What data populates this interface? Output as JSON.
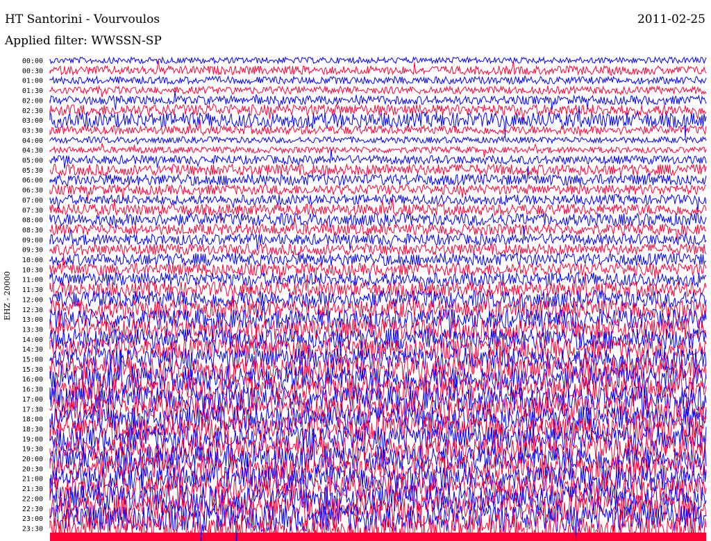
{
  "header": {
    "station": "HT Santorini - Vourvoulos",
    "date": "2011-02-25",
    "filter": "Applied filter: WWSSN-SP",
    "channel": "EHZ - 20000"
  },
  "chart_data": {
    "type": "line",
    "title": "HT Santorini - Vourvoulos",
    "subtitle": "Applied filter: WWSSN-SP",
    "ylabel": "EHZ - 20000",
    "colors": {
      "odd": "#0000ff",
      "even": "#ff0033"
    },
    "tick_labels": [
      "00:00",
      "00:30",
      "01:00",
      "01:30",
      "02:00",
      "02:30",
      "03:00",
      "03:30",
      "04:00",
      "04:30",
      "05:00",
      "05:30",
      "06:00",
      "06:30",
      "07:00",
      "07:30",
      "08:00",
      "08:30",
      "09:00",
      "09:30",
      "10:00",
      "10:30",
      "11:00",
      "11:30",
      "12:00",
      "12:30",
      "13:00",
      "13:30",
      "14:00",
      "14:30",
      "15:00",
      "15:30",
      "16:00",
      "16:30",
      "17:00",
      "17:30",
      "18:00",
      "18:30",
      "19:00",
      "19:30",
      "20:00",
      "20:30",
      "21:00",
      "21:30",
      "22:00",
      "22:30",
      "23:00",
      "23:30"
    ],
    "trace_amplitude": [
      0.25,
      0.35,
      0.3,
      0.3,
      0.35,
      0.45,
      0.6,
      0.35,
      0.25,
      0.25,
      0.35,
      0.45,
      0.45,
      0.4,
      0.4,
      0.45,
      0.5,
      0.45,
      0.45,
      0.45,
      0.5,
      0.5,
      0.55,
      0.6,
      0.7,
      0.75,
      0.8,
      0.85,
      0.85,
      0.85,
      0.9,
      0.95,
      1.0,
      1.0,
      1.0,
      1.0,
      1.0,
      1.0,
      1.0,
      1.0,
      1.0,
      1.0,
      1.0,
      1.0,
      1.05,
      1.1,
      1.1,
      1.1
    ],
    "grid": false
  }
}
